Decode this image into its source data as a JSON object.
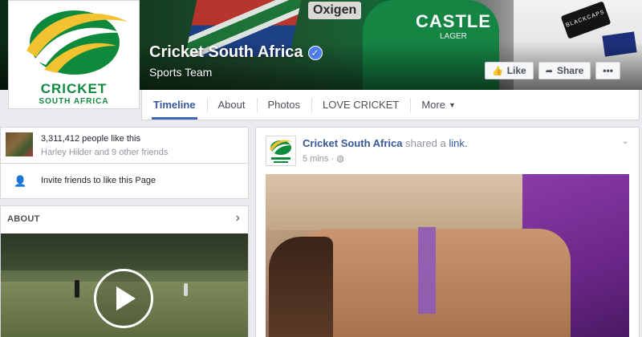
{
  "page": {
    "name": "Cricket South Africa",
    "category": "Sports Team",
    "logo_line1": "CRICKET",
    "logo_line2": "SOUTH AFRICA",
    "verified_icon": "check-icon"
  },
  "cover": {
    "sponsor_text": "Oxigen",
    "jersey_brand": "CASTLE",
    "jersey_sub": "LAGER",
    "placard_text": "BLACKCAPS"
  },
  "actions": {
    "like_label": "Like",
    "share_label": "Share",
    "more_label": "•••"
  },
  "nav": {
    "tabs": [
      {
        "label": "Timeline"
      },
      {
        "label": "About"
      },
      {
        "label": "Photos"
      },
      {
        "label": "LOVE CRICKET"
      },
      {
        "label": "More"
      }
    ]
  },
  "sidebar": {
    "likes_count": "3,311,412 people like this",
    "friends_like": "Harley Hilder and 9 other friends",
    "invite_label": "Invite friends to like this Page",
    "about_header": "ABOUT"
  },
  "post": {
    "author": "Cricket South Africa",
    "action": "shared a",
    "link_text": "link.",
    "time": "5 mins · "
  },
  "colors": {
    "link": "#365899",
    "logo_green": "#0f8a3d",
    "logo_yellow": "#f2c230",
    "verified_blue": "#4c7ef0"
  }
}
